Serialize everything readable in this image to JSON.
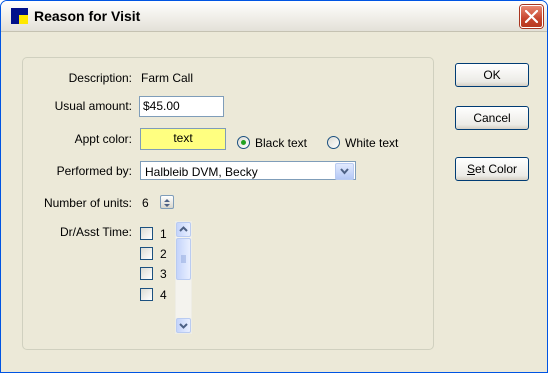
{
  "window": {
    "title": "Reason for Visit"
  },
  "form": {
    "description_label": "Description:",
    "description_value": "Farm Call",
    "usual_amount_label": "Usual amount:",
    "usual_amount_value": "$45.00",
    "appt_color_label": "Appt color:",
    "appt_color_sample_text": "text",
    "appt_color_sample_bg": "#ffff80",
    "black_text_label": "Black text",
    "white_text_label": "White text",
    "selected_text_color": "Black text",
    "performed_by_label": "Performed by:",
    "performed_by_value": "Halbleib DVM, Becky",
    "number_of_units_label": "Number of units:",
    "number_of_units_value": "6",
    "dr_asst_time_label": "Dr/Asst Time:",
    "time_slots": [
      "1",
      "2",
      "3",
      "4"
    ]
  },
  "buttons": {
    "ok_label": "OK",
    "cancel_label": "Cancel",
    "set_color_prefix": "S",
    "set_color_rest": "et Color"
  },
  "icons": [
    "app-icon",
    "close-icon",
    "chevron-down-icon",
    "spin-icon",
    "scroll-up-icon",
    "scroll-down-icon"
  ]
}
